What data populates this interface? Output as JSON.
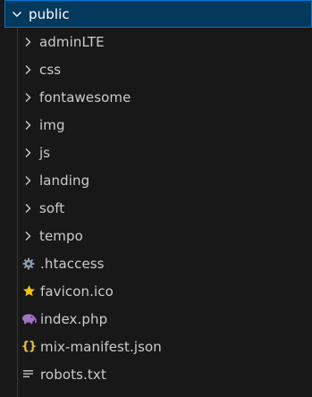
{
  "root": {
    "label": "public",
    "expanded": true
  },
  "folders": [
    {
      "label": "adminLTE"
    },
    {
      "label": "css"
    },
    {
      "label": "fontawesome"
    },
    {
      "label": "img"
    },
    {
      "label": "js"
    },
    {
      "label": "landing"
    },
    {
      "label": "soft"
    },
    {
      "label": "tempo"
    }
  ],
  "files": [
    {
      "label": ".htaccess",
      "icon": "gear-icon",
      "color": "#8a9aad"
    },
    {
      "label": "favicon.ico",
      "icon": "star-icon",
      "color": "#f1c40f"
    },
    {
      "label": "index.php",
      "icon": "php-elephant-icon",
      "color": "#a074c4"
    },
    {
      "label": "mix-manifest.json",
      "icon": "json-braces-icon",
      "color": "#e8c341"
    },
    {
      "label": "robots.txt",
      "icon": "text-lines-icon",
      "color": "#c5c5c5"
    }
  ],
  "colors": {
    "background": "#181818",
    "selected_background": "#04395e",
    "selected_border": "#0078d4",
    "text": "#cccccc"
  }
}
